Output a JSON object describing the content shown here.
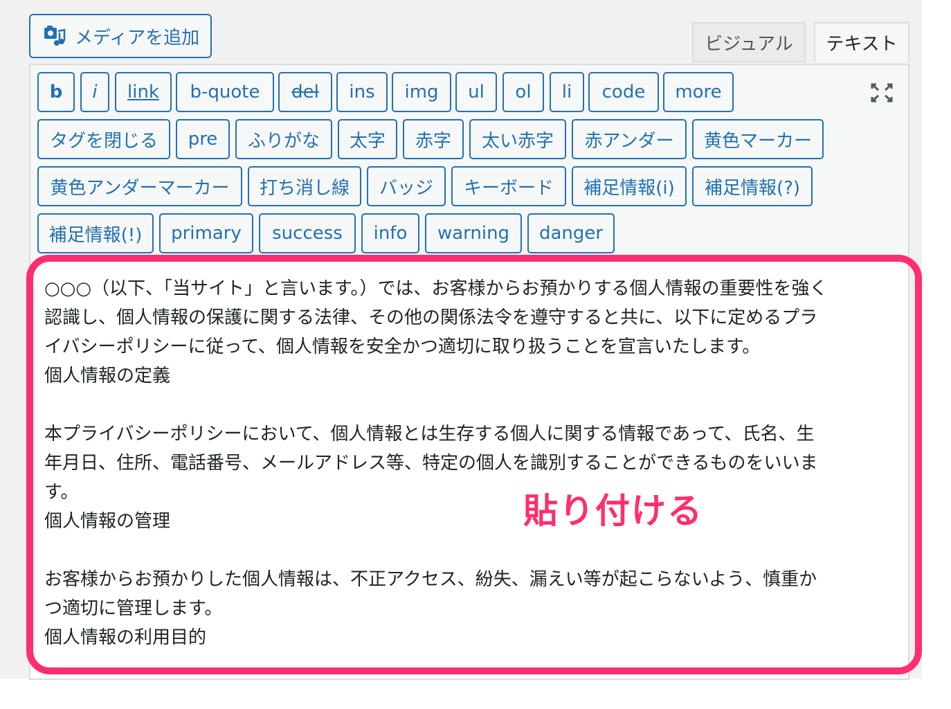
{
  "toolbar": {
    "add_media_label": "メディアを追加",
    "tabs": {
      "visual": "ビジュアル",
      "text": "テキスト"
    }
  },
  "quicktags": [
    {
      "label": "b"
    },
    {
      "label": "i"
    },
    {
      "label": "link"
    },
    {
      "label": "b-quote"
    },
    {
      "label": "del"
    },
    {
      "label": "ins"
    },
    {
      "label": "img"
    },
    {
      "label": "ul"
    },
    {
      "label": "ol"
    },
    {
      "label": "li"
    },
    {
      "label": "code"
    },
    {
      "label": "more"
    },
    {
      "label": "タグを閉じる"
    },
    {
      "label": "pre"
    },
    {
      "label": "ふりがな"
    },
    {
      "label": "太字"
    },
    {
      "label": "赤字"
    },
    {
      "label": "太い赤字"
    },
    {
      "label": "赤アンダー"
    },
    {
      "label": "黄色マーカー"
    },
    {
      "label": "黄色アンダーマーカー"
    },
    {
      "label": "打ち消し線"
    },
    {
      "label": "バッジ"
    },
    {
      "label": "キーボード"
    },
    {
      "label": "補足情報(i)"
    },
    {
      "label": "補足情報(?)"
    },
    {
      "label": "補足情報(!)"
    },
    {
      "label": "primary"
    },
    {
      "label": "success"
    },
    {
      "label": "info"
    },
    {
      "label": "warning"
    },
    {
      "label": "danger"
    }
  ],
  "content": {
    "lines": [
      "○○○（以下、「当サイト」と言います。）では、お客様からお預かりする個人情報の重要性を強く",
      "認識し、個人情報の保護に関する法律、その他の関係法令を遵守すると共に、以下に定めるプラ",
      "イバシーポリシーに従って、個人情報を安全かつ適切に取り扱うことを宣言いたします。",
      "個人情報の定義",
      "",
      "本プライバシーポリシーにおいて、個人情報とは生存する個人に関する情報であって、氏名、生",
      "年月日、住所、電話番号、メールアドレス等、特定の個人を識別することができるものをいいま",
      "す。",
      "個人情報の管理",
      "",
      "お客様からお預かりした個人情報は、不正アクセス、紛失、漏えい等が起こらないよう、慎重か",
      "つ適切に管理します。",
      "個人情報の利用目的"
    ]
  },
  "annotation": {
    "label": "貼り付ける",
    "color": "#ff2e6e"
  }
}
